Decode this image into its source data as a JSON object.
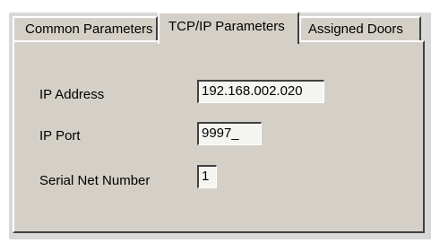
{
  "tabs": [
    {
      "label": "Common Parameters",
      "active": false
    },
    {
      "label": "TCP/IP Parameters",
      "active": true
    },
    {
      "label": "Assigned Doors",
      "active": false
    }
  ],
  "form": {
    "ip_address": {
      "label": "IP Address",
      "value": "192.168.002.020"
    },
    "ip_port": {
      "label": "IP Port",
      "value": "9997_"
    },
    "serial_net_number": {
      "label": "Serial Net Number",
      "value": "1"
    }
  },
  "colors": {
    "panel_background": "#d4d0c8",
    "field_background": "#f4f4f0"
  }
}
